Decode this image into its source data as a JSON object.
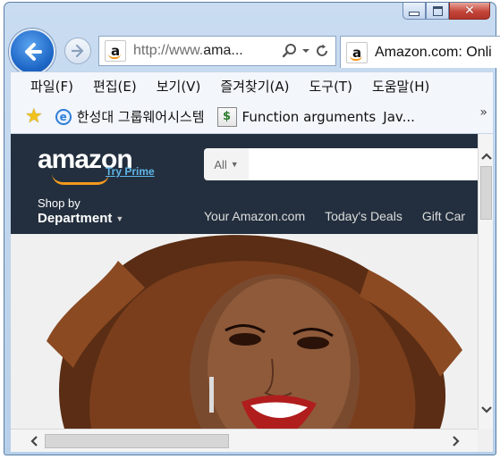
{
  "window": {
    "caption_buttons": [
      "minimize",
      "maximize",
      "close"
    ]
  },
  "nav": {
    "back_icon": "back-arrow-icon",
    "forward_icon": "forward-arrow-icon",
    "address": {
      "url_prefix": "http://www.",
      "url_domain": "ama...",
      "favicon": "a"
    },
    "tab": {
      "favicon": "a",
      "title": "Amazon.com: Onli"
    }
  },
  "menubar": {
    "items": [
      "파일(F)",
      "편집(E)",
      "보기(V)",
      "즐겨찾기(A)",
      "도구(T)",
      "도움말(H)"
    ]
  },
  "favorites": {
    "items": [
      "한성대 그룹웨어시스템",
      "Function arguments",
      "Jav..."
    ],
    "more": "»"
  },
  "amazon": {
    "logo": "amazon",
    "try_prime": "Try Prime",
    "search_category": "All",
    "shop_by": "Shop by",
    "department": "Department",
    "nav_links": [
      "Your Amazon.com",
      "Today's Deals",
      "Gift Car"
    ]
  },
  "colors": {
    "amazon_header": "#232f3e",
    "accent_orange": "#f39a1e",
    "ie_blue": "#1d66c6"
  }
}
